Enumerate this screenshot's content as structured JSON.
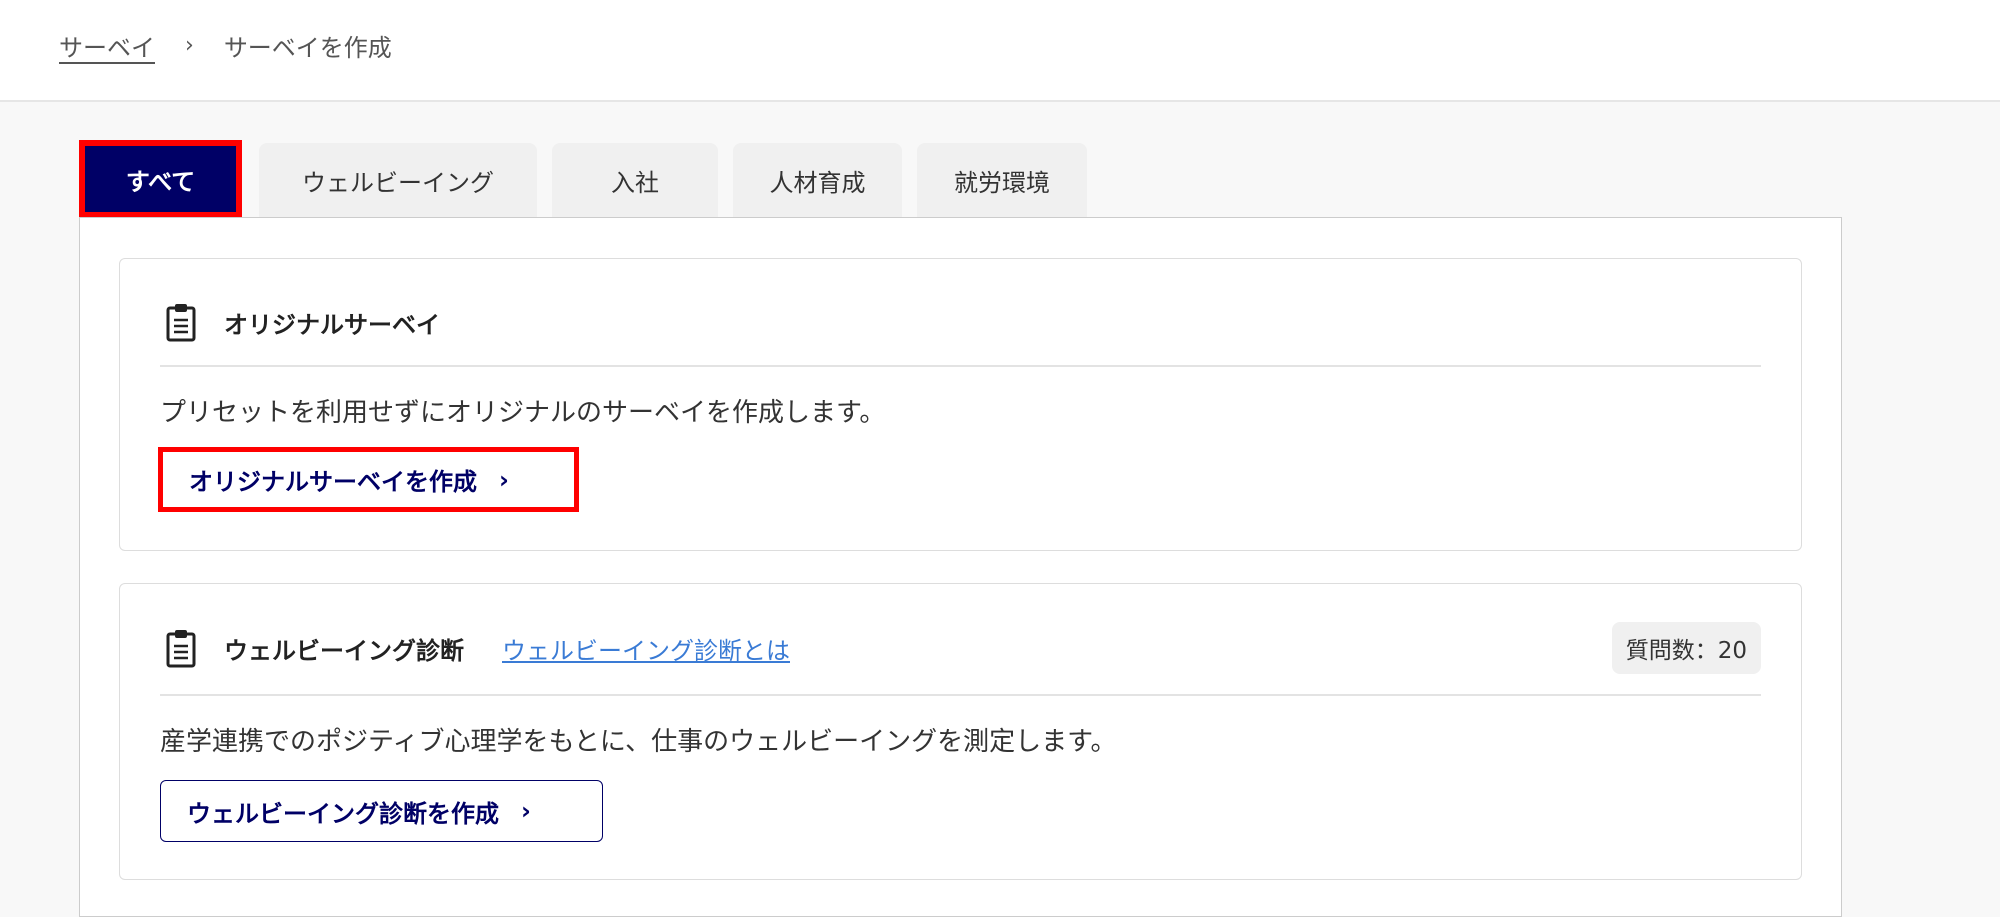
{
  "breadcrumb": {
    "parent": "サーベイ",
    "separator": "›",
    "current": "サーベイを作成"
  },
  "tabs": [
    {
      "label": "すべて",
      "active": true
    },
    {
      "label": "ウェルビーイング"
    },
    {
      "label": "入社"
    },
    {
      "label": "人材育成"
    },
    {
      "label": "就労環境"
    }
  ],
  "cards": [
    {
      "icon": "clipboard-icon",
      "title": "オリジナルサーベイ",
      "description": "プリセットを利用せずにオリジナルのサーベイを作成します。",
      "button": "オリジナルサーベイを作成",
      "chevron": "›"
    },
    {
      "icon": "clipboard-icon",
      "title": "ウェルビーイング診断",
      "link": "ウェルビーイング診断とは",
      "badge": "質問数：20",
      "description": "産学連携でのポジティブ心理学をもとに、仕事のウェルビーイングを測定します。",
      "button": "ウェルビーイング診断を作成",
      "chevron": "›"
    }
  ],
  "colors": {
    "primary": "#000066",
    "highlight": "#ff0000",
    "link": "#3a7bd5"
  }
}
